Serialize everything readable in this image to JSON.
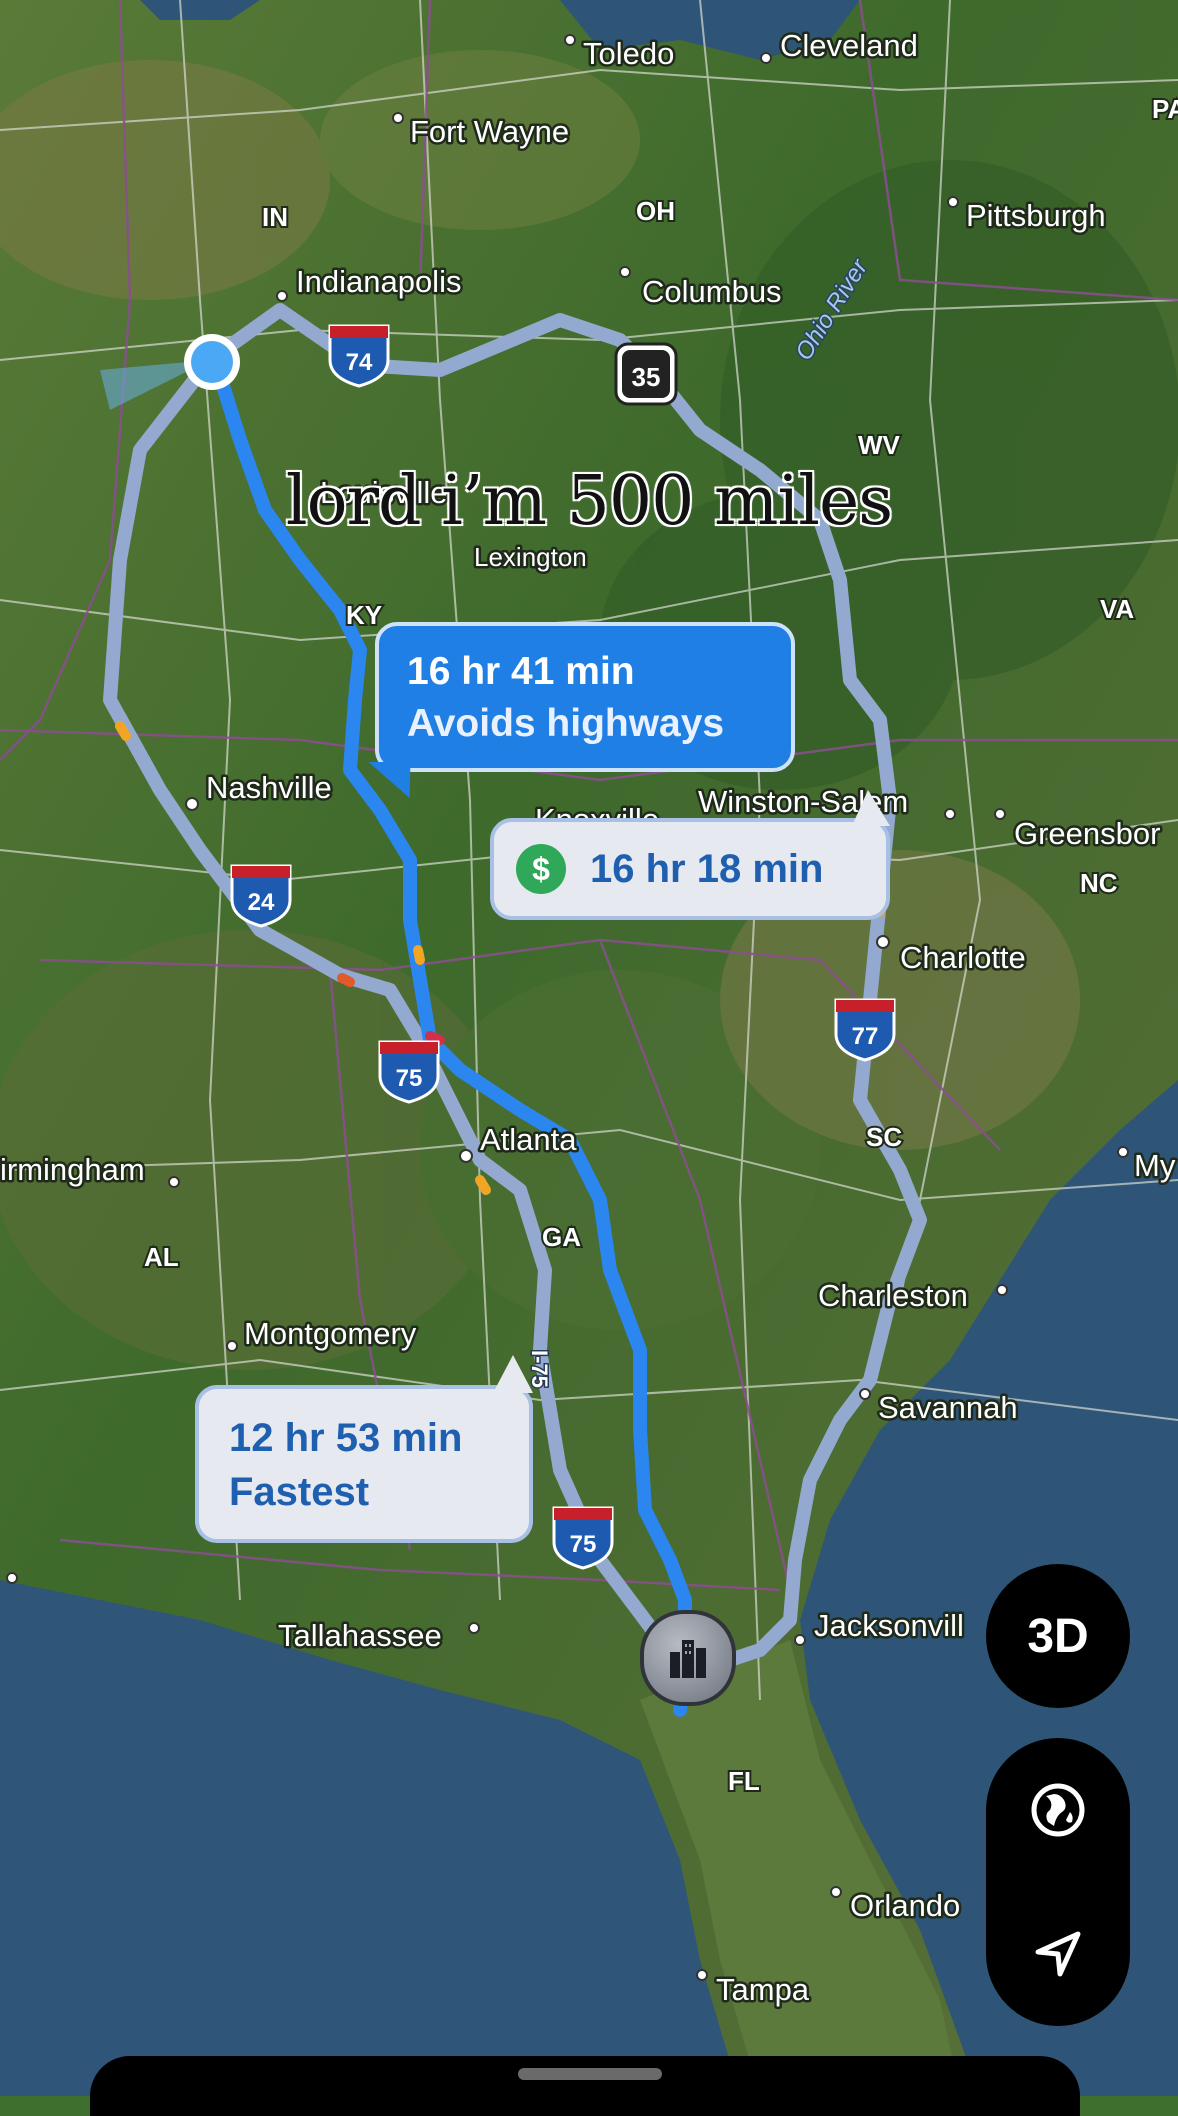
{
  "caption": "lord i’m 500 miles",
  "cities": {
    "toledo": "Toledo",
    "cleveland": "Cleveland",
    "fort_wayne": "Fort Wayne",
    "pittsburgh": "Pittsburgh",
    "indianapolis": "Indianapolis",
    "columbus": "Columbus",
    "louisville": "Louisville",
    "lexington": "Lexington",
    "nashville": "Nashville",
    "winston_salem": "Winston-Salem",
    "greensboro": "Greensbor",
    "knoxville": "Knoxville",
    "charlotte": "Charlotte",
    "atlanta": "Atlanta",
    "birmingham": "irmingham",
    "myrtle": "My",
    "montgomery": "Montgomery",
    "charleston": "Charleston",
    "savannah": "Savannah",
    "tallahassee": "Tallahassee",
    "jacksonville": "Jacksonvill",
    "orlando": "Orlando",
    "tampa": "Tampa"
  },
  "states": {
    "in": "IN",
    "oh": "OH",
    "pa": "PA",
    "wv": "WV",
    "va": "VA",
    "ky": "KY",
    "nc": "NC",
    "sc": "SC",
    "ga": "GA",
    "al": "AL",
    "fl": "FL"
  },
  "river": "Ohio River",
  "shields": {
    "i74": "74",
    "us35": "35",
    "i24": "24",
    "i75_north": "75",
    "i77": "77",
    "i75_south": "75",
    "i75_vertical": "I-75"
  },
  "routes": [
    {
      "duration": "16 hr 41 min",
      "note": "Avoids highways",
      "selected": true
    },
    {
      "duration": "16 hr 18 min",
      "note": "",
      "has_toll": true,
      "toll_icon": "$"
    },
    {
      "duration": "12 hr 53 min",
      "note": "Fastest",
      "selected": false
    }
  ],
  "controls": {
    "view_3d_label": "3D",
    "globe_icon": "globe-icon",
    "location_icon": "location-arrow-icon"
  },
  "colors": {
    "selected_route": "#2b86f0",
    "alt_route": "#93a9cf",
    "current_location": "#4aa8f5",
    "water": "#2e5577"
  }
}
